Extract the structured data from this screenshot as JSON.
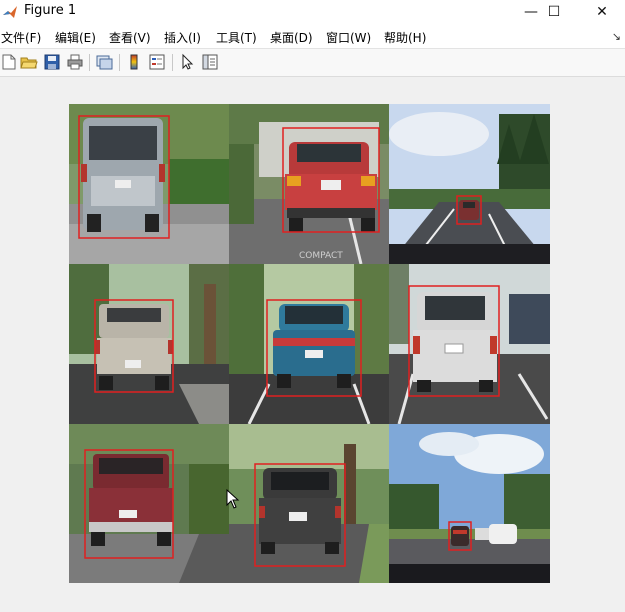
{
  "window": {
    "title": "Figure 1",
    "minimize_glyph": "—",
    "maximize_glyph": "☐",
    "close_glyph": "✕"
  },
  "menu": {
    "items": [
      "文件(F)",
      "编辑(E)",
      "查看(V)",
      "插入(I)",
      "工具(T)",
      "桌面(D)",
      "窗口(W)",
      "帮助(H)"
    ],
    "more_glyph": "↘"
  },
  "toolbar": {
    "icons": [
      "new-figure-icon",
      "open-file-icon",
      "save-icon",
      "print-icon",
      "link-plot-icon",
      "insert-colorbar-icon",
      "insert-legend-icon",
      "edit-plot-arrow-icon",
      "property-inspector-icon"
    ]
  },
  "figure": {
    "bbox_color": "#e02020",
    "tiles": [
      {
        "name": "tile-1",
        "vehicle": "silver minivan rear",
        "sky": "#c9d6b0",
        "ground": "#8f8f8f",
        "car_color": "#9ea7ae"
      },
      {
        "name": "tile-2",
        "vehicle": "red sedan rear",
        "sky": "#b8c49a",
        "ground": "#6e6e6e",
        "car_color": "#c84040"
      },
      {
        "name": "tile-3",
        "vehicle": "distant car on road",
        "sky": "#c8d8ee",
        "ground": "#4a4d52",
        "car_color": "#7a3030"
      },
      {
        "name": "tile-4",
        "vehicle": "white pickup rear",
        "sky": "#a8c0a0",
        "ground": "#3f4040",
        "car_color": "#b9b4a8"
      },
      {
        "name": "tile-5",
        "vehicle": "teal sedan rear",
        "sky": "#b5c9a2",
        "ground": "#3c3c3c",
        "car_color": "#2a6d8e"
      },
      {
        "name": "tile-6",
        "vehicle": "white wagon rear",
        "sky": "#d0d8d8",
        "ground": "#4a4a4a",
        "car_color": "#dcdcdc"
      },
      {
        "name": "tile-7",
        "vehicle": "maroon pickup rear",
        "sky": "#5f7a50",
        "ground": "#7b7b7b",
        "car_color": "#7a2a30"
      },
      {
        "name": "tile-8",
        "vehicle": "dark hatchback rear",
        "sky": "#6f8f5a",
        "ground": "#5a5a5a",
        "car_color": "#3a3a3a"
      },
      {
        "name": "tile-9",
        "vehicle": "car on highway",
        "sky": "#7fa8d8",
        "ground": "#5a5a5e",
        "car_color": "#3a2a2a"
      }
    ]
  }
}
